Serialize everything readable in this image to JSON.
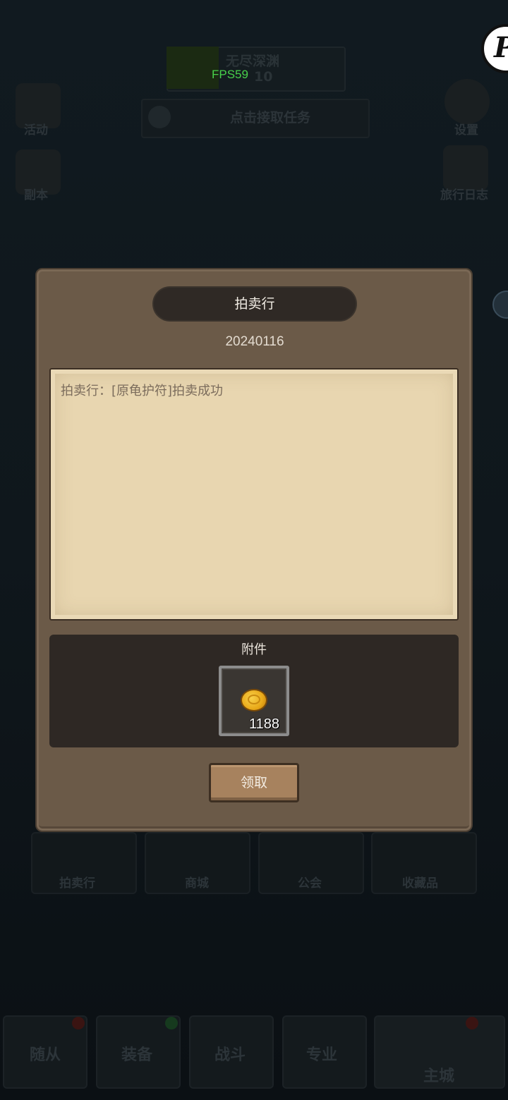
{
  "fps": "FPS59",
  "background": {
    "stage_name": "无尽深渊",
    "stage_number": "10",
    "quest_text": "点击接取任务",
    "left_menu": [
      {
        "label": "活动"
      },
      {
        "label": "副本"
      }
    ],
    "right_menu": [
      {
        "label": "设置"
      },
      {
        "label": "旅行日志"
      }
    ],
    "feature_buttons": [
      {
        "label": "拍卖行"
      },
      {
        "label": "商城"
      },
      {
        "label": "公会"
      },
      {
        "label": "收藏品"
      }
    ],
    "bottom_nav": [
      {
        "label": "随从"
      },
      {
        "label": "装备"
      },
      {
        "label": "战斗"
      },
      {
        "label": "专业"
      },
      {
        "label": "主城"
      }
    ]
  },
  "mail": {
    "title": "拍卖行",
    "date": "20240116",
    "body": "拍卖行：[原龟护符]拍卖成功",
    "attachment_label": "附件",
    "attachments": [
      {
        "icon": "gold-coin-icon",
        "count": "1188"
      }
    ],
    "claim_label": "领取"
  },
  "colors": {
    "modal_bg": "#6b5a48",
    "paper": "#e8d6b0",
    "panel_dark": "#2e2824",
    "button_wood": "#a7825e",
    "fps_green": "#47d04a"
  }
}
